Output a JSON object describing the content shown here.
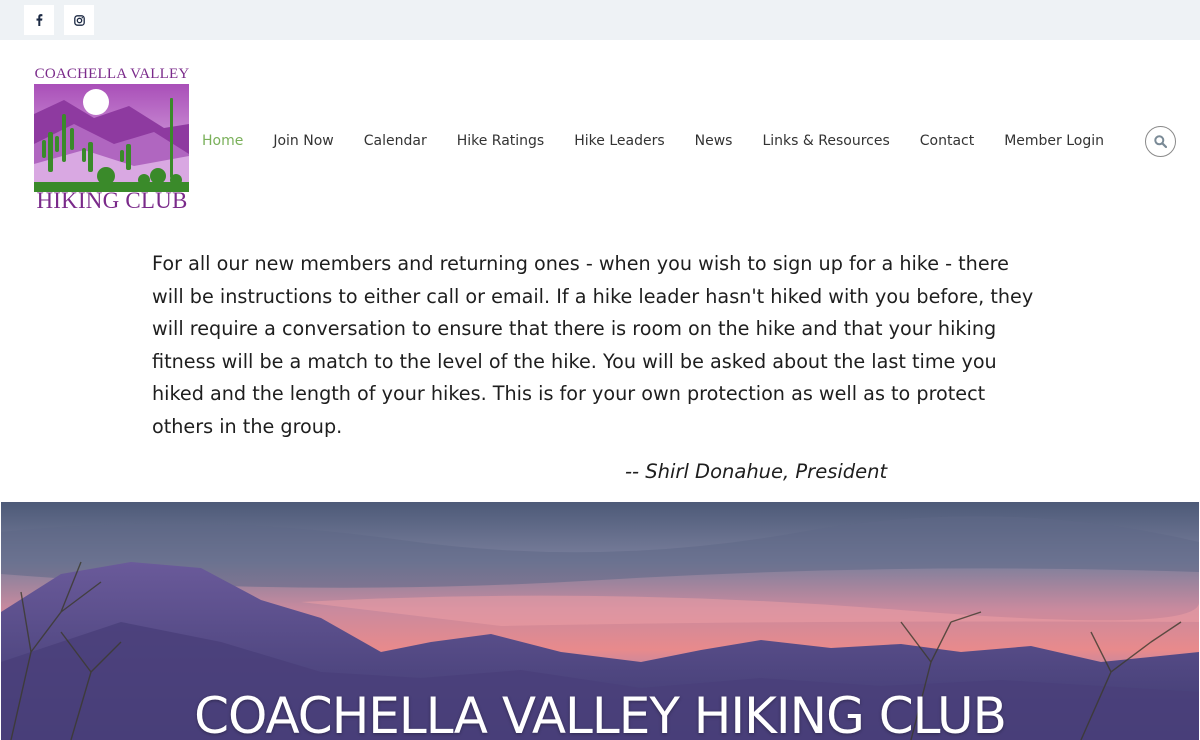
{
  "social": {
    "facebook_icon": "facebook-icon",
    "instagram_icon": "instagram-icon"
  },
  "logo": {
    "top_text": "COACHELLA VALLEY",
    "bottom_text": "HIKING CLUB"
  },
  "nav": {
    "items": [
      {
        "label": "Home",
        "active": true
      },
      {
        "label": "Join Now"
      },
      {
        "label": "Calendar"
      },
      {
        "label": "Hike Ratings"
      },
      {
        "label": "Hike Leaders"
      },
      {
        "label": "News"
      },
      {
        "label": "Links & Resources"
      },
      {
        "label": "Contact"
      },
      {
        "label": "Member Login"
      }
    ],
    "search_icon": "search-icon"
  },
  "message": {
    "lines": [
      "For all our new members and returning ones - when you wish to sign up for a hike - there",
      "will be instructions to either call or email.   If a hike leader hasn't hiked with you before, they",
      "will require a conversation to ensure that there is room on the hike and that your hiking",
      "fitness will be a match to the level of the hike. You will be asked about the last time you",
      "hiked and the length of your hikes.  This is for your own protection as well as to protect",
      "others in the group."
    ],
    "signature": "-- Shirl Donahue, President"
  },
  "hero": {
    "title": "COACHELLA VALLEY HIKING CLUB"
  },
  "colors": {
    "accent": "#7ab05a",
    "brand_purple": "#7a2a8a",
    "topbar": "#eef2f5"
  }
}
